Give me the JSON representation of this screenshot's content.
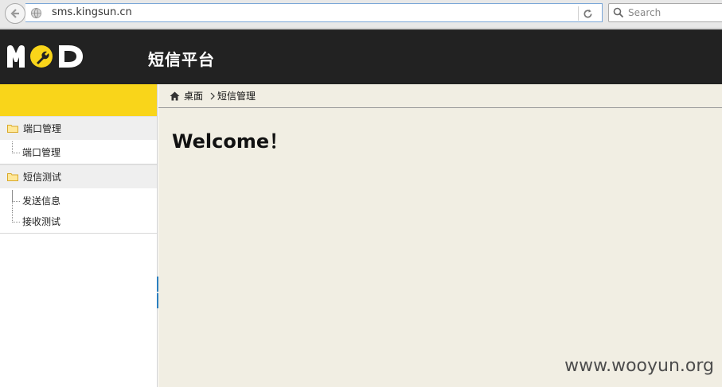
{
  "browser": {
    "url": "sms.kingsun.cn",
    "search_placeholder": "Search"
  },
  "header": {
    "logo_text": "MOD",
    "title": "短信平台",
    "colors": {
      "background": "#222222",
      "logo": "#ffffff",
      "logo_accent": "#f9d51a"
    }
  },
  "sidebar": {
    "accent_color": "#f9d51a",
    "groups": [
      {
        "label": "端口管理",
        "items": [
          {
            "label": "端口管理"
          }
        ]
      },
      {
        "label": "短信测试",
        "items": [
          {
            "label": "发送信息"
          },
          {
            "label": "接收测试"
          }
        ]
      }
    ]
  },
  "breadcrumb": {
    "home_label": "桌面",
    "current_label": "短信管理"
  },
  "main": {
    "welcome": "Welcome！",
    "background": "#f1eee3"
  },
  "watermark": "www.wooyun.org"
}
